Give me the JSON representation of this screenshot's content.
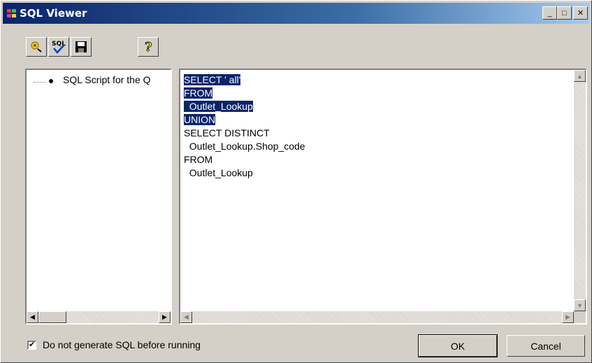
{
  "window": {
    "title": "SQL Viewer"
  },
  "caption_buttons": {
    "minimize": "_",
    "maximize": "□",
    "close": "✕"
  },
  "toolbar": {
    "buttons": [
      {
        "icon": "run-query-icon"
      },
      {
        "icon": "sql-check-icon",
        "text": "SQL"
      },
      {
        "icon": "save-icon"
      },
      {
        "icon": "help-icon"
      }
    ]
  },
  "tree": {
    "items": [
      {
        "label": "SQL Script for the Q"
      }
    ]
  },
  "editor": {
    "lines": [
      {
        "text": "SELECT ' all'",
        "selected": true
      },
      {
        "text": "FROM",
        "selected": true
      },
      {
        "text": "  Outlet_Lookup",
        "selected": true
      },
      {
        "text": "UNION",
        "selected": true
      },
      {
        "text": "SELECT DISTINCT",
        "selected": false
      },
      {
        "text": "  Outlet_Lookup.Shop_code",
        "selected": false
      },
      {
        "text": "FROM",
        "selected": false
      },
      {
        "text": "  Outlet_Lookup",
        "selected": false
      }
    ]
  },
  "footer": {
    "checkbox_label": "Do not generate SQL before running",
    "checkbox_checked": true,
    "ok_label": "OK",
    "cancel_label": "Cancel"
  },
  "colors": {
    "title_start": "#0a246a",
    "selection": "#0a246a",
    "face": "#d4d0c8"
  }
}
